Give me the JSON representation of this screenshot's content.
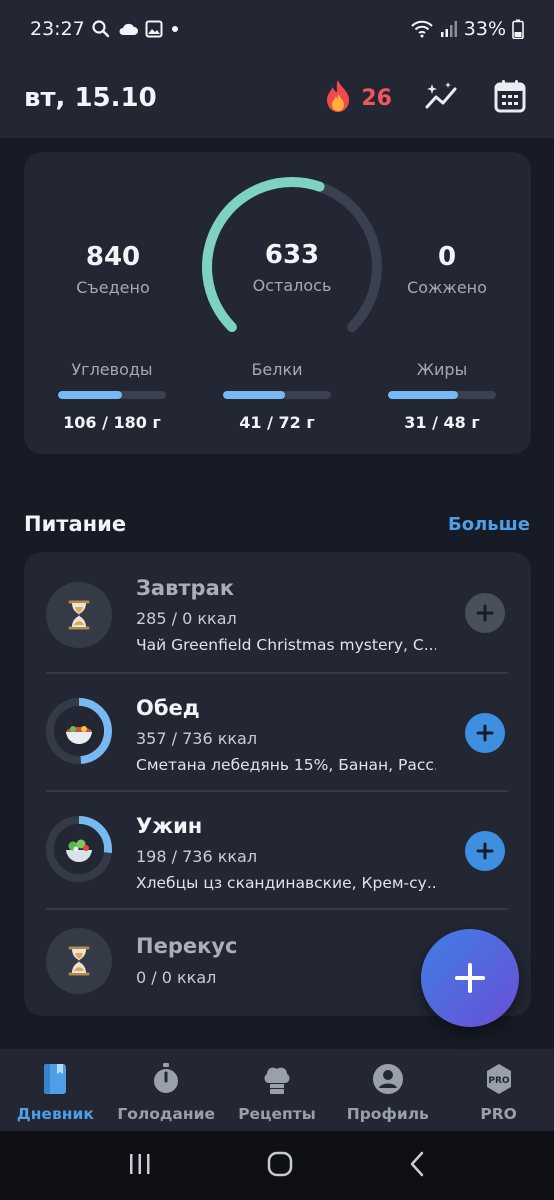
{
  "status_bar": {
    "time": "23:27",
    "battery": "33%"
  },
  "header": {
    "date": "вт, 15.10",
    "streak": "26"
  },
  "summary": {
    "eaten_value": "840",
    "eaten_label": "Съедено",
    "remaining_value": "633",
    "remaining_label": "Осталось",
    "burned_value": "0",
    "burned_label": "Сожжено",
    "remaining_progress": 0.57,
    "macros": [
      {
        "label": "Углеводы",
        "value": "106 / 180 г",
        "progress": 0.59
      },
      {
        "label": "Белки",
        "value": "41 / 72 г",
        "progress": 0.57
      },
      {
        "label": "Жиры",
        "value": "31 / 48 г",
        "progress": 0.65
      }
    ]
  },
  "nutrition": {
    "title": "Питание",
    "more": "Больше",
    "meals": [
      {
        "name": "Завтрак",
        "kcal": "285 / 0 ккал",
        "items": "Чай Greenfield Christmas mystery, С...",
        "icon": "hourglass-icon",
        "progress": 0
      },
      {
        "name": "Обед",
        "kcal": "357 / 736 ккал",
        "items": "Сметана лебедянь 15%, Банан, Расс...",
        "icon": "salad-bowl-icon",
        "progress": 0.49
      },
      {
        "name": "Ужин",
        "kcal": "198 / 736 ккал",
        "items": "Хлебцы цз скандинавские, Крем-су...",
        "icon": "green-salad-icon",
        "progress": 0.27
      },
      {
        "name": "Перекус",
        "kcal": "0 / 0 ккал",
        "items": "",
        "icon": "hourglass-icon",
        "progress": 0
      }
    ]
  },
  "bottom_nav": [
    {
      "label": "Дневник",
      "icon": "diary-icon"
    },
    {
      "label": "Голодание",
      "icon": "stopwatch-icon"
    },
    {
      "label": "Рецепты",
      "icon": "chef-hat-icon"
    },
    {
      "label": "Профиль",
      "icon": "profile-icon"
    },
    {
      "label": "PRO",
      "icon": "pro-badge-icon"
    }
  ],
  "colors": {
    "accent": "#4f9ee8",
    "ring": "#7dd3c0",
    "macro_bar": "#78b9f3",
    "streak": "#f0565a"
  }
}
